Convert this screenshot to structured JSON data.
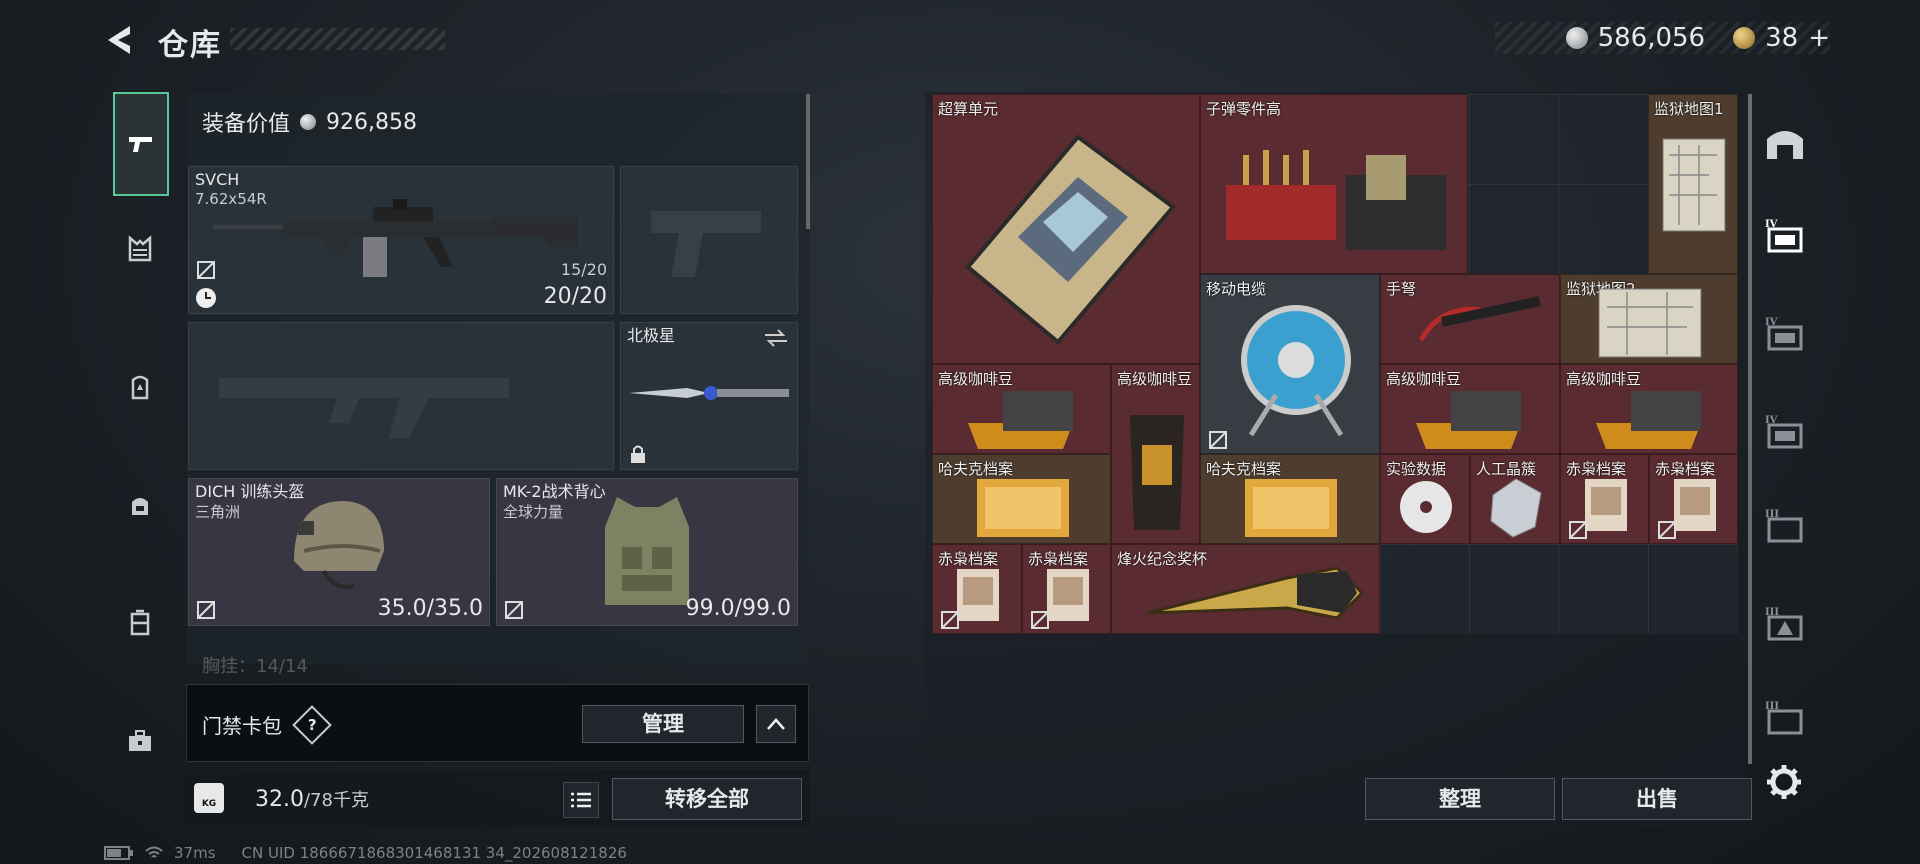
{
  "header": {
    "title": "仓库"
  },
  "currency": {
    "silver": "586,056",
    "gold": "38",
    "gold_plus": "+"
  },
  "equipment": {
    "label": "装备价值",
    "value": "926,858",
    "primary_weapon": {
      "name": "SVCH",
      "caliber": "7.62x54R",
      "ammo_small": "15/20",
      "ammo": "20/20"
    },
    "melee": {
      "name": "北极星"
    },
    "helmet": {
      "name": "DICH 训练头盔",
      "maker": "三角洲",
      "durability": "35.0/35.0"
    },
    "vest": {
      "name": "MK-2战术背心",
      "maker": "全球力量",
      "durability": "99.0/99.0"
    },
    "chest_rig": "胸挂：14/14"
  },
  "access_card": {
    "label": "门禁卡包",
    "help": "?",
    "manage": "管理"
  },
  "capacity": {
    "current": "32.0",
    "max": "/78千克",
    "icon_text": "KG"
  },
  "actions": {
    "transfer_all": "转移全部",
    "sort": "整理",
    "sell": "出售"
  },
  "status": {
    "ping": "37ms",
    "uid": "CN UID 1866671868301468131 34_202608121826"
  },
  "storage_items": [
    {
      "id": "supercompute",
      "name": "超算单元"
    },
    {
      "id": "bullet_parts",
      "name": "子弹零件高"
    },
    {
      "id": "prison_map_1",
      "name": "监狱地图1"
    },
    {
      "id": "mobile_cable",
      "name": "移动电缆"
    },
    {
      "id": "crossbow",
      "name": "手弩"
    },
    {
      "id": "prison_map_2",
      "name": "监狱地图2"
    },
    {
      "id": "coffee_1",
      "name": "高级咖啡豆"
    },
    {
      "id": "coffee_2",
      "name": "高级咖啡豆"
    },
    {
      "id": "coffee_3",
      "name": "高级咖啡豆"
    },
    {
      "id": "coffee_4",
      "name": "高级咖啡豆"
    },
    {
      "id": "huff_1",
      "name": "哈夫克档案"
    },
    {
      "id": "huff_2",
      "name": "哈夫克档案"
    },
    {
      "id": "exp_data",
      "name": "实验数据"
    },
    {
      "id": "crystal",
      "name": "人工晶簇"
    },
    {
      "id": "owl_1",
      "name": "赤枭档案"
    },
    {
      "id": "owl_2",
      "name": "赤枭档案"
    },
    {
      "id": "owl_3",
      "name": "赤枭档案"
    },
    {
      "id": "owl_4",
      "name": "赤枭档案"
    },
    {
      "id": "trophy",
      "name": "烽火纪念奖杯"
    }
  ],
  "colors": {
    "accent": "#58c795",
    "rare_red": "#5a2c31",
    "rare_gold": "#4e3d2e"
  }
}
